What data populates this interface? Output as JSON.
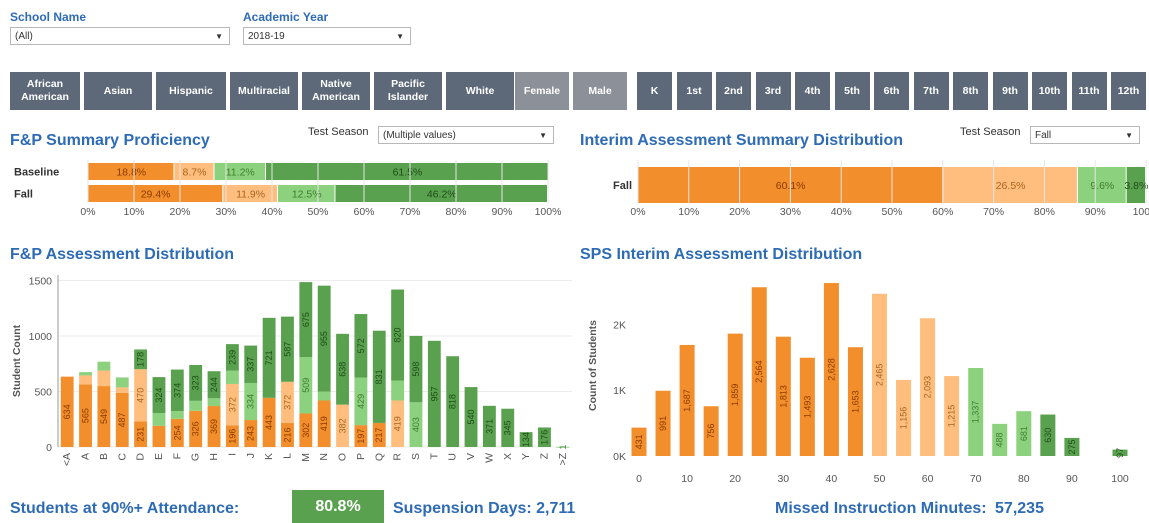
{
  "filters": {
    "school": {
      "label": "School Name",
      "value": "(All)"
    },
    "year": {
      "label": "Academic Year",
      "value": "2018-19"
    }
  },
  "ethnicity_buttons": [
    "African\nAmerican",
    "Asian",
    "Hispanic",
    "Multiracial",
    "Native\nAmerican",
    "Pacific\nIslander",
    "White"
  ],
  "gender_buttons": [
    "Female",
    "Male"
  ],
  "grade_buttons": [
    "K",
    "1st",
    "2nd",
    "3rd",
    "4th",
    "5th",
    "6th",
    "7th",
    "8th",
    "9th",
    "10th",
    "11th",
    "12th"
  ],
  "fp_summary": {
    "title": "F&P Summary Proficiency",
    "season_label": "Test Season",
    "season_value": "(Multiple values)"
  },
  "interim_summary": {
    "title": "Interim Assessment Summary Distribution",
    "season_label": "Test Season",
    "season_value": "Fall"
  },
  "fp_dist": {
    "title": "F&P Assessment Distribution"
  },
  "sps_dist": {
    "title": "SPS Interim Assessment Distribution"
  },
  "footer": {
    "attendance_label": "Students at 90%+ Attendance:",
    "attendance_value": "80.8%",
    "suspension_label": "Suspension Days:",
    "suspension_value": "2,711",
    "missed_label": "Missed Instruction Minutes:",
    "missed_value": "57,235"
  },
  "colors": {
    "dark_orange": "#f28e2b",
    "light_orange": "#ffbe7d",
    "light_green": "#8cd17d",
    "dark_green": "#59a14f",
    "title_blue": "#2e6bb5",
    "button": "#5d6978"
  },
  "chart_data": [
    {
      "type": "bar",
      "subtype": "stacked-horizontal-percent",
      "title": "F&P Summary Proficiency",
      "categories": [
        "Baseline",
        "Fall"
      ],
      "series": [
        {
          "color": "#f28e2b",
          "values": [
            18.8,
            29.4
          ],
          "labels": [
            "18.8%",
            "29.4%"
          ]
        },
        {
          "color": "#ffbe7d",
          "values": [
            8.7,
            11.9
          ],
          "labels": [
            "8.7%",
            "11.9%"
          ]
        },
        {
          "color": "#8cd17d",
          "values": [
            11.2,
            12.5
          ],
          "labels": [
            "11.2%",
            "12.5%"
          ]
        },
        {
          "color": "#59a14f",
          "values": [
            61.5,
            46.2
          ],
          "labels": [
            "61.5%",
            "46.2%"
          ]
        }
      ],
      "xticks": [
        "0%",
        "10%",
        "20%",
        "30%",
        "40%",
        "50%",
        "60%",
        "70%",
        "80%",
        "90%",
        "100%"
      ],
      "xlim": [
        0,
        100
      ]
    },
    {
      "type": "bar",
      "subtype": "stacked-horizontal-percent",
      "title": "Interim Assessment Summary Distribution",
      "categories": [
        "Fall"
      ],
      "series": [
        {
          "color": "#f28e2b",
          "values": [
            60.1
          ],
          "labels": [
            "60.1%"
          ]
        },
        {
          "color": "#ffbe7d",
          "values": [
            26.5
          ],
          "labels": [
            "26.5%"
          ]
        },
        {
          "color": "#8cd17d",
          "values": [
            9.6
          ],
          "labels": [
            "9.6%"
          ]
        },
        {
          "color": "#59a14f",
          "values": [
            3.8
          ],
          "labels": [
            "3.8%"
          ]
        }
      ],
      "xticks": [
        "0%",
        "10%",
        "20%",
        "30%",
        "40%",
        "50%",
        "60%",
        "70%",
        "80%",
        "90%",
        "100%"
      ],
      "xlim": [
        0,
        100
      ]
    },
    {
      "type": "bar",
      "subtype": "stacked",
      "title": "F&P Assessment Distribution",
      "ylabel": "Student Count",
      "ylim": [
        0,
        1550
      ],
      "yticks": [
        0,
        500,
        1000,
        1500
      ],
      "categories": [
        "<A",
        "A",
        "B",
        "C",
        "D",
        "E",
        "F",
        "G",
        "H",
        "I",
        "J",
        "K",
        "L",
        "M",
        "N",
        "O",
        "P",
        "Q",
        "R",
        "S",
        "T",
        "U",
        "V",
        "W",
        "X",
        "Y",
        "Z",
        ">Z"
      ],
      "series": [
        {
          "color": "#f28e2b",
          "values": [
            634,
            565,
            549,
            487,
            231,
            191,
            254,
            326,
            369,
            196,
            243,
            443,
            216,
            302,
            419,
            0,
            197,
            217,
            0,
            0,
            0,
            0,
            0,
            0,
            0,
            0,
            0,
            0
          ],
          "labels": [
            "634",
            "565",
            "549",
            "487",
            "231",
            "",
            "254",
            "326",
            "369",
            "196",
            "243",
            "443",
            "216",
            "302",
            "419",
            "",
            "197",
            "217",
            "",
            "",
            "",
            "",
            "",
            "",
            "",
            "",
            "",
            ""
          ]
        },
        {
          "color": "#ffbe7d",
          "values": [
            0,
            80,
            140,
            50,
            470,
            0,
            0,
            0,
            0,
            372,
            0,
            0,
            372,
            0,
            0,
            382,
            0,
            0,
            419,
            0,
            0,
            0,
            0,
            0,
            0,
            0,
            0,
            0
          ],
          "labels": [
            "",
            "",
            "",
            "",
            "470",
            "",
            "",
            "",
            "",
            "372",
            "",
            "",
            "372",
            "",
            "",
            "382",
            "",
            "",
            "419",
            "",
            "",
            "",
            "",
            "",
            "",
            "",
            "",
            ""
          ]
        },
        {
          "color": "#8cd17d",
          "values": [
            0,
            30,
            80,
            90,
            0,
            115,
            70,
            90,
            70,
            120,
            334,
            0,
            0,
            509,
            80,
            0,
            429,
            0,
            180,
            403,
            0,
            0,
            0,
            0,
            0,
            0,
            0,
            1
          ],
          "labels": [
            "",
            "",
            "",
            "",
            "",
            "",
            "",
            "",
            "",
            "",
            "334",
            "",
            "",
            "509",
            "",
            "",
            "429",
            "",
            "",
            "403",
            "",
            "",
            "",
            "",
            "",
            "",
            "",
            "1"
          ]
        },
        {
          "color": "#59a14f",
          "values": [
            0,
            0,
            0,
            0,
            178,
            324,
            374,
            323,
            244,
            239,
            337,
            721,
            587,
            675,
            955,
            638,
            572,
            831,
            820,
            598,
            957,
            818,
            540,
            371,
            345,
            134,
            176,
            0
          ],
          "labels": [
            "",
            "",
            "",
            "",
            "178",
            "324",
            "374",
            "323",
            "244",
            "239",
            "337",
            "721",
            "587",
            "675",
            "955",
            "638",
            "572",
            "831",
            "820",
            "598",
            "957",
            "818",
            "540",
            "371",
            "345",
            "134",
            "176",
            ""
          ]
        }
      ]
    },
    {
      "type": "bar",
      "title": "SPS Interim Assessment Distribution",
      "ylabel": "Count of Students",
      "ylim": [
        0,
        2750
      ],
      "yticks": [
        "0K",
        "1K",
        "2K"
      ],
      "xticks": [
        0,
        10,
        20,
        30,
        40,
        50,
        60,
        70,
        80,
        90,
        100
      ],
      "x": [
        0,
        5,
        10,
        15,
        20,
        25,
        30,
        35,
        40,
        45,
        50,
        55,
        60,
        65,
        70,
        75,
        80,
        85,
        90,
        100
      ],
      "values": [
        431,
        991,
        1687,
        756,
        1859,
        2564,
        1813,
        1493,
        2628,
        1653,
        2465,
        1156,
        2093,
        1215,
        1337,
        488,
        681,
        630,
        275,
        97
      ],
      "labels": [
        "431",
        "991",
        "1,687",
        "756",
        "1,859",
        "2,564",
        "1,813",
        "1,493",
        "2,628",
        "1,653",
        "2,465",
        "1,156",
        "2,093",
        "1,215",
        "1,337",
        "488",
        "681",
        "630",
        "275",
        "97"
      ],
      "colors": [
        "#f28e2b",
        "#f28e2b",
        "#f28e2b",
        "#f28e2b",
        "#f28e2b",
        "#f28e2b",
        "#f28e2b",
        "#f28e2b",
        "#f28e2b",
        "#f28e2b",
        "#ffbe7d",
        "#ffbe7d",
        "#ffbe7d",
        "#ffbe7d",
        "#8cd17d",
        "#8cd17d",
        "#8cd17d",
        "#59a14f",
        "#59a14f",
        "#59a14f"
      ]
    }
  ]
}
